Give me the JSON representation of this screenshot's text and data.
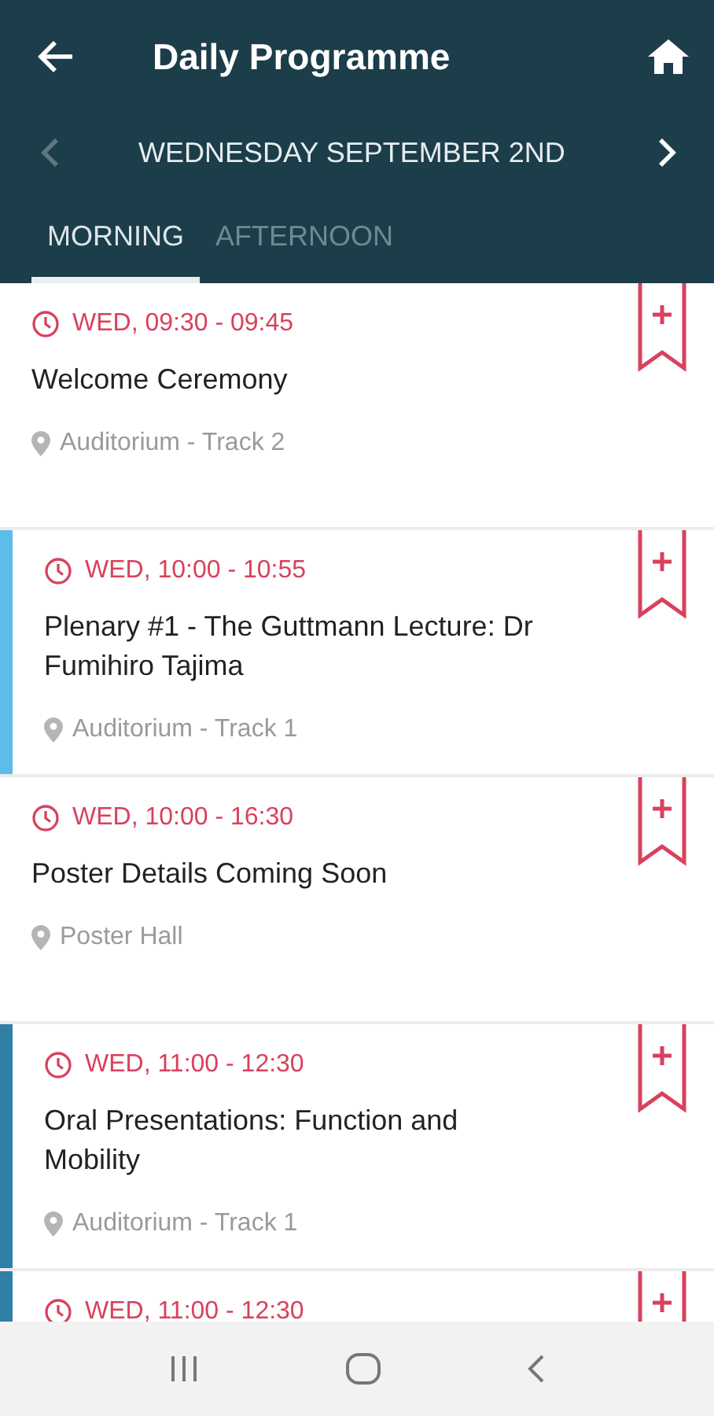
{
  "app_bar": {
    "title": "Daily Programme"
  },
  "date_nav": {
    "label": "WEDNESDAY SEPTEMBER 2ND",
    "prev_disabled": true,
    "next_disabled": false
  },
  "tabs": [
    {
      "label": "MORNING",
      "selected": true
    },
    {
      "label": "AFTERNOON",
      "selected": false
    }
  ],
  "sessions": [
    {
      "time": "WED, 09:30 - 09:45",
      "title": "Welcome Ceremony",
      "location": "Auditorium - Track 2"
    },
    {
      "time": "WED, 10:00 - 10:55",
      "title": "Plenary #1 - The Guttmann Lecture: Dr Fumihiro Tajima",
      "location": "Auditorium - Track 1",
      "color": "#5bbde8"
    },
    {
      "time": "WED, 10:00 - 16:30",
      "title": "Poster Details Coming Soon",
      "location": "Poster Hall"
    },
    {
      "time": "WED, 11:00 - 12:30",
      "title": "Oral Presentations: Function and Mobility",
      "location": "Auditorium - Track 1",
      "color": "#2f7fa6"
    },
    {
      "time": "WED, 11:00 - 12:30",
      "color": "#2f7fa6"
    }
  ]
}
